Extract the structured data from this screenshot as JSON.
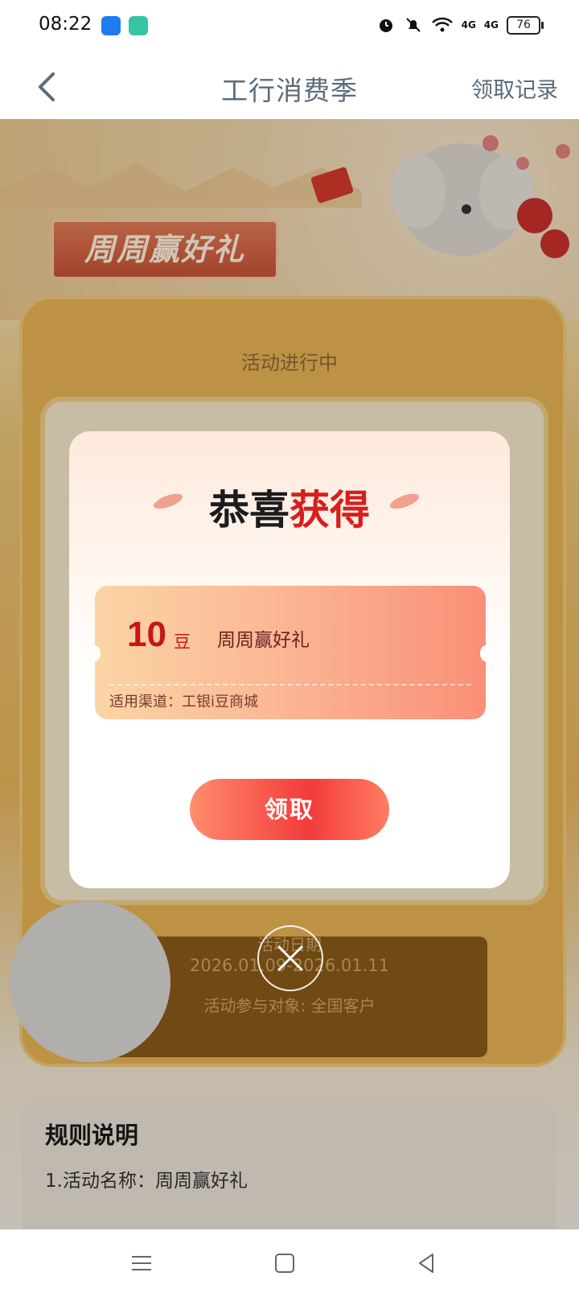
{
  "status_bar": {
    "time": "08:22",
    "signal_a": "4G",
    "signal_b": "4G",
    "battery": "76"
  },
  "nav": {
    "title": "工行消费季",
    "right_link": "领取记录"
  },
  "banner": {
    "title": "周周赢好礼"
  },
  "activity": {
    "status": "活动进行中",
    "date_label": "活动日期",
    "date_range": "2026.01.09-2026.01.11",
    "participants": "活动参与对象:   全国客户"
  },
  "rules": {
    "title": "规则说明",
    "line1": "1.活动名称：周周赢好礼"
  },
  "modal": {
    "title_part1": "恭喜",
    "title_part2": "获得",
    "coupon": {
      "amount": "10",
      "unit": "豆",
      "name": "周周赢好礼",
      "channel": "适用渠道：工银i豆商城"
    },
    "claim_button": "领取"
  },
  "colors": {
    "accent_red": "#d81e1e",
    "nav_text": "#5b6b7a",
    "button_red": "#f33a3a"
  },
  "icons": [
    "back-arrow-icon",
    "close-icon",
    "menu-icon",
    "home-icon",
    "back-triangle-icon",
    "alarm-icon",
    "mute-icon",
    "wifi-icon"
  ]
}
